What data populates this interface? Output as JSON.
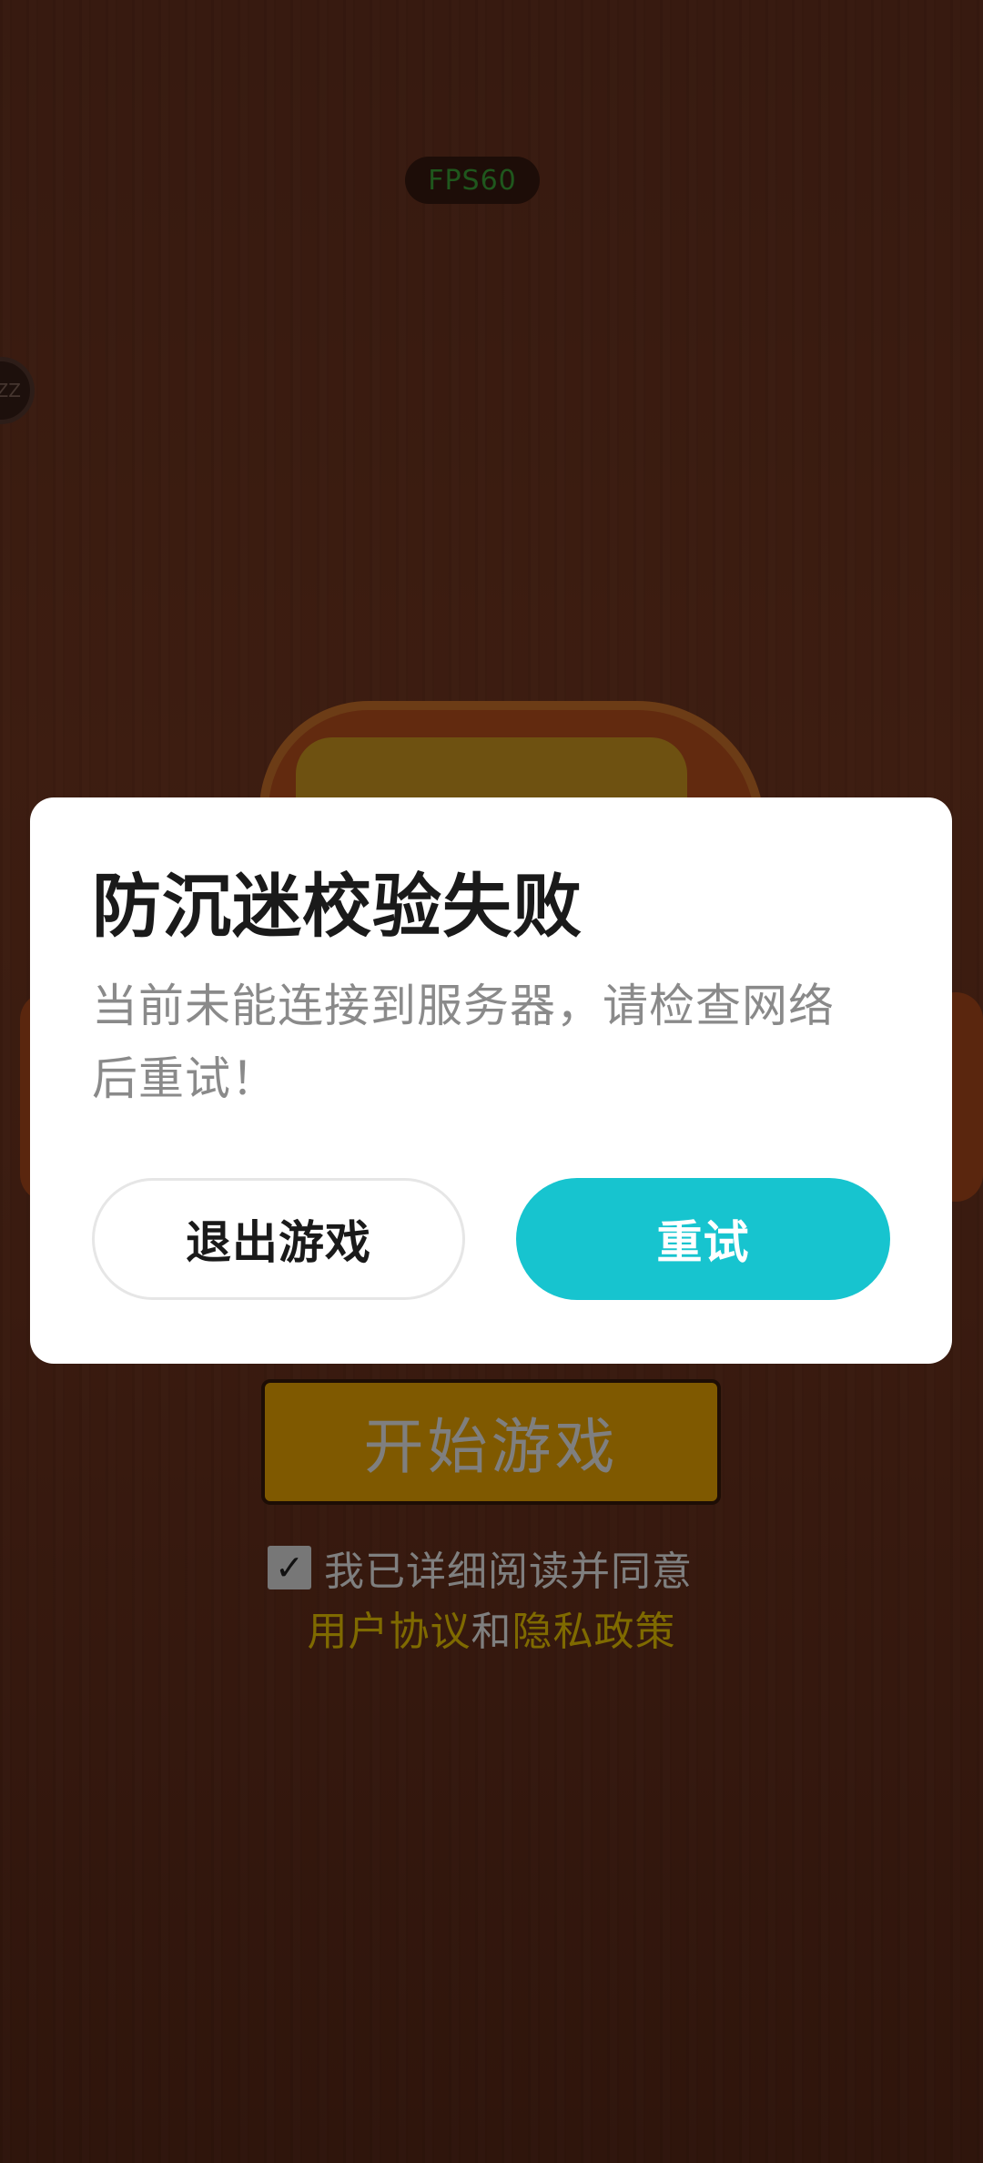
{
  "game": {
    "fps_label": "FPS60",
    "float_ball_label": "ZZ",
    "start_button_label": "开始游戏",
    "agreement": {
      "checked": true,
      "check_mark": "✓",
      "text": "我已详细阅读并同意",
      "user_agreement_link": "用户协议",
      "and_text": "和",
      "privacy_policy_link": "隐私政策"
    }
  },
  "dialog": {
    "title": "防沉迷校验失败",
    "message_line1": "当前未能连接到服务器，请检查网络",
    "message_line2": "后重试！",
    "exit_button_label": "退出游戏",
    "retry_button_label": "重试"
  },
  "colors": {
    "retry_button": "#17c4cf",
    "start_button": "#ffb300",
    "link": "#ffd400",
    "fps_text": "#3fae3a"
  }
}
